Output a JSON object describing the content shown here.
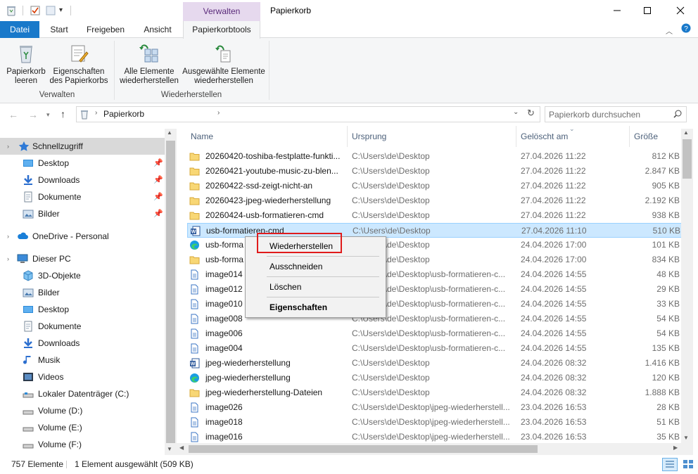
{
  "window": {
    "title": "Papierkorb",
    "context_tab_header": "Verwalten"
  },
  "ribbon": {
    "tabs": [
      "Datei",
      "Start",
      "Freigeben",
      "Ansicht",
      "Papierkorbtools"
    ],
    "active_tab": "Papierkorbtools",
    "groups": [
      {
        "label": "Verwalten",
        "buttons": [
          {
            "line1": "Papierkorb",
            "line2": "leeren",
            "icon": "recycle-bin-empty-icon"
          },
          {
            "line1": "Eigenschaften",
            "line2": "des Papierkorbs",
            "icon": "properties-icon"
          }
        ]
      },
      {
        "label": "Wiederherstellen",
        "buttons": [
          {
            "line1": "Alle Elemente",
            "line2": "wiederherstellen",
            "icon": "restore-all-icon"
          },
          {
            "line1": "Ausgewählte Elemente",
            "line2": "wiederherstellen",
            "icon": "restore-selected-icon"
          }
        ]
      }
    ]
  },
  "address": {
    "breadcrumb": "Papierkorb",
    "search_placeholder": "Papierkorb durchsuchen"
  },
  "nav": {
    "items": [
      {
        "label": "Schnellzugriff",
        "icon": "star-icon",
        "selected": true
      },
      {
        "label": "Desktop",
        "icon": "desktop-icon",
        "pinned": true
      },
      {
        "label": "Downloads",
        "icon": "download-icon",
        "pinned": true
      },
      {
        "label": "Dokumente",
        "icon": "documents-icon",
        "pinned": true
      },
      {
        "label": "Bilder",
        "icon": "pictures-icon",
        "pinned": true
      },
      {
        "label": "OneDrive - Personal",
        "icon": "cloud-icon"
      },
      {
        "label": "Dieser PC",
        "icon": "computer-icon"
      },
      {
        "label": "3D-Objekte",
        "icon": "cube-icon"
      },
      {
        "label": "Bilder",
        "icon": "pictures-icon"
      },
      {
        "label": "Desktop",
        "icon": "desktop-icon"
      },
      {
        "label": "Dokumente",
        "icon": "documents-icon"
      },
      {
        "label": "Downloads",
        "icon": "download-icon"
      },
      {
        "label": "Musik",
        "icon": "music-icon"
      },
      {
        "label": "Videos",
        "icon": "video-icon"
      },
      {
        "label": "Lokaler Datenträger (C:)",
        "icon": "drive-icon"
      },
      {
        "label": "Volume (D:)",
        "icon": "drive-icon"
      },
      {
        "label": "Volume (E:)",
        "icon": "drive-icon"
      },
      {
        "label": "Volume (F:)",
        "icon": "drive-icon"
      }
    ]
  },
  "list": {
    "columns": [
      "Name",
      "Ursprung",
      "Gelöscht am",
      "Größe"
    ],
    "rows": [
      {
        "name": "20260420-toshiba-festplatte-funkti...",
        "origin": "C:\\Users\\de\\Desktop",
        "deleted": "27.04.2026 11:22",
        "size": "812 KB",
        "type": "folder"
      },
      {
        "name": "20260421-youtube-music-zu-blen...",
        "origin": "C:\\Users\\de\\Desktop",
        "deleted": "27.04.2026 11:22",
        "size": "2.847 KB",
        "type": "folder"
      },
      {
        "name": "20260422-ssd-zeigt-nicht-an",
        "origin": "C:\\Users\\de\\Desktop",
        "deleted": "27.04.2026 11:22",
        "size": "905 KB",
        "type": "folder"
      },
      {
        "name": "20260423-jpeg-wiederherstellung",
        "origin": "C:\\Users\\de\\Desktop",
        "deleted": "27.04.2026 11:22",
        "size": "2.192 KB",
        "type": "folder"
      },
      {
        "name": "20260424-usb-formatieren-cmd",
        "origin": "C:\\Users\\de\\Desktop",
        "deleted": "27.04.2026 11:22",
        "size": "938 KB",
        "type": "folder"
      },
      {
        "name": "usb-formatieren-cmd",
        "origin": "C:\\Users\\de\\Desktop",
        "deleted": "27.04.2026 11:10",
        "size": "510 KB",
        "type": "word",
        "selected": true
      },
      {
        "name": "usb-forma",
        "origin": "C:\\Users\\de\\Desktop",
        "deleted": "24.04.2026 17:00",
        "size": "101 KB",
        "type": "edge"
      },
      {
        "name": "usb-forma",
        "origin": "C:\\Users\\de\\Desktop",
        "deleted": "24.04.2026 17:00",
        "size": "834 KB",
        "type": "folder"
      },
      {
        "name": "image014",
        "origin": "C:\\Users\\de\\Desktop\\usb-formatieren-c...",
        "deleted": "24.04.2026 14:55",
        "size": "48 KB",
        "type": "file"
      },
      {
        "name": "image012",
        "origin": "C:\\Users\\de\\Desktop\\usb-formatieren-c...",
        "deleted": "24.04.2026 14:55",
        "size": "29 KB",
        "type": "file"
      },
      {
        "name": "image010",
        "origin": "C:\\Users\\de\\Desktop\\usb-formatieren-c...",
        "deleted": "24.04.2026 14:55",
        "size": "33 KB",
        "type": "file"
      },
      {
        "name": "image008",
        "origin": "C:\\Users\\de\\Desktop\\usb-formatieren-c...",
        "deleted": "24.04.2026 14:55",
        "size": "54 KB",
        "type": "file"
      },
      {
        "name": "image006",
        "origin": "C:\\Users\\de\\Desktop\\usb-formatieren-c...",
        "deleted": "24.04.2026 14:55",
        "size": "54 KB",
        "type": "file"
      },
      {
        "name": "image004",
        "origin": "C:\\Users\\de\\Desktop\\usb-formatieren-c...",
        "deleted": "24.04.2026 14:55",
        "size": "135 KB",
        "type": "file"
      },
      {
        "name": "jpeg-wiederherstellung",
        "origin": "C:\\Users\\de\\Desktop",
        "deleted": "24.04.2026 08:32",
        "size": "1.416 KB",
        "type": "word"
      },
      {
        "name": "jpeg-wiederherstellung",
        "origin": "C:\\Users\\de\\Desktop",
        "deleted": "24.04.2026 08:32",
        "size": "120 KB",
        "type": "edge"
      },
      {
        "name": "jpeg-wiederherstellung-Dateien",
        "origin": "C:\\Users\\de\\Desktop",
        "deleted": "24.04.2026 08:32",
        "size": "1.888 KB",
        "type": "folder"
      },
      {
        "name": "image026",
        "origin": "C:\\Users\\de\\Desktop\\jpeg-wiederherstell...",
        "deleted": "23.04.2026 16:53",
        "size": "28 KB",
        "type": "file"
      },
      {
        "name": "image018",
        "origin": "C:\\Users\\de\\Desktop\\jpeg-wiederherstell...",
        "deleted": "23.04.2026 16:53",
        "size": "51 KB",
        "type": "file"
      },
      {
        "name": "image016",
        "origin": "C:\\Users\\de\\Desktop\\jpeg-wiederherstell...",
        "deleted": "23.04.2026 16:53",
        "size": "35 KB",
        "type": "file"
      }
    ]
  },
  "context_menu": {
    "items": [
      "Wiederherstellen",
      "Ausschneiden",
      "Löschen",
      "Eigenschaften"
    ],
    "highlighted": "Wiederherstellen",
    "bold_item": "Eigenschaften"
  },
  "status": {
    "count": "757 Elemente",
    "selection": "1 Element ausgewählt (509 KB)"
  },
  "colors": {
    "accent": "#1979ca",
    "selection": "#cce8ff",
    "highlight_box": "#e01b1b",
    "context_tab": "#e6d9ee"
  }
}
